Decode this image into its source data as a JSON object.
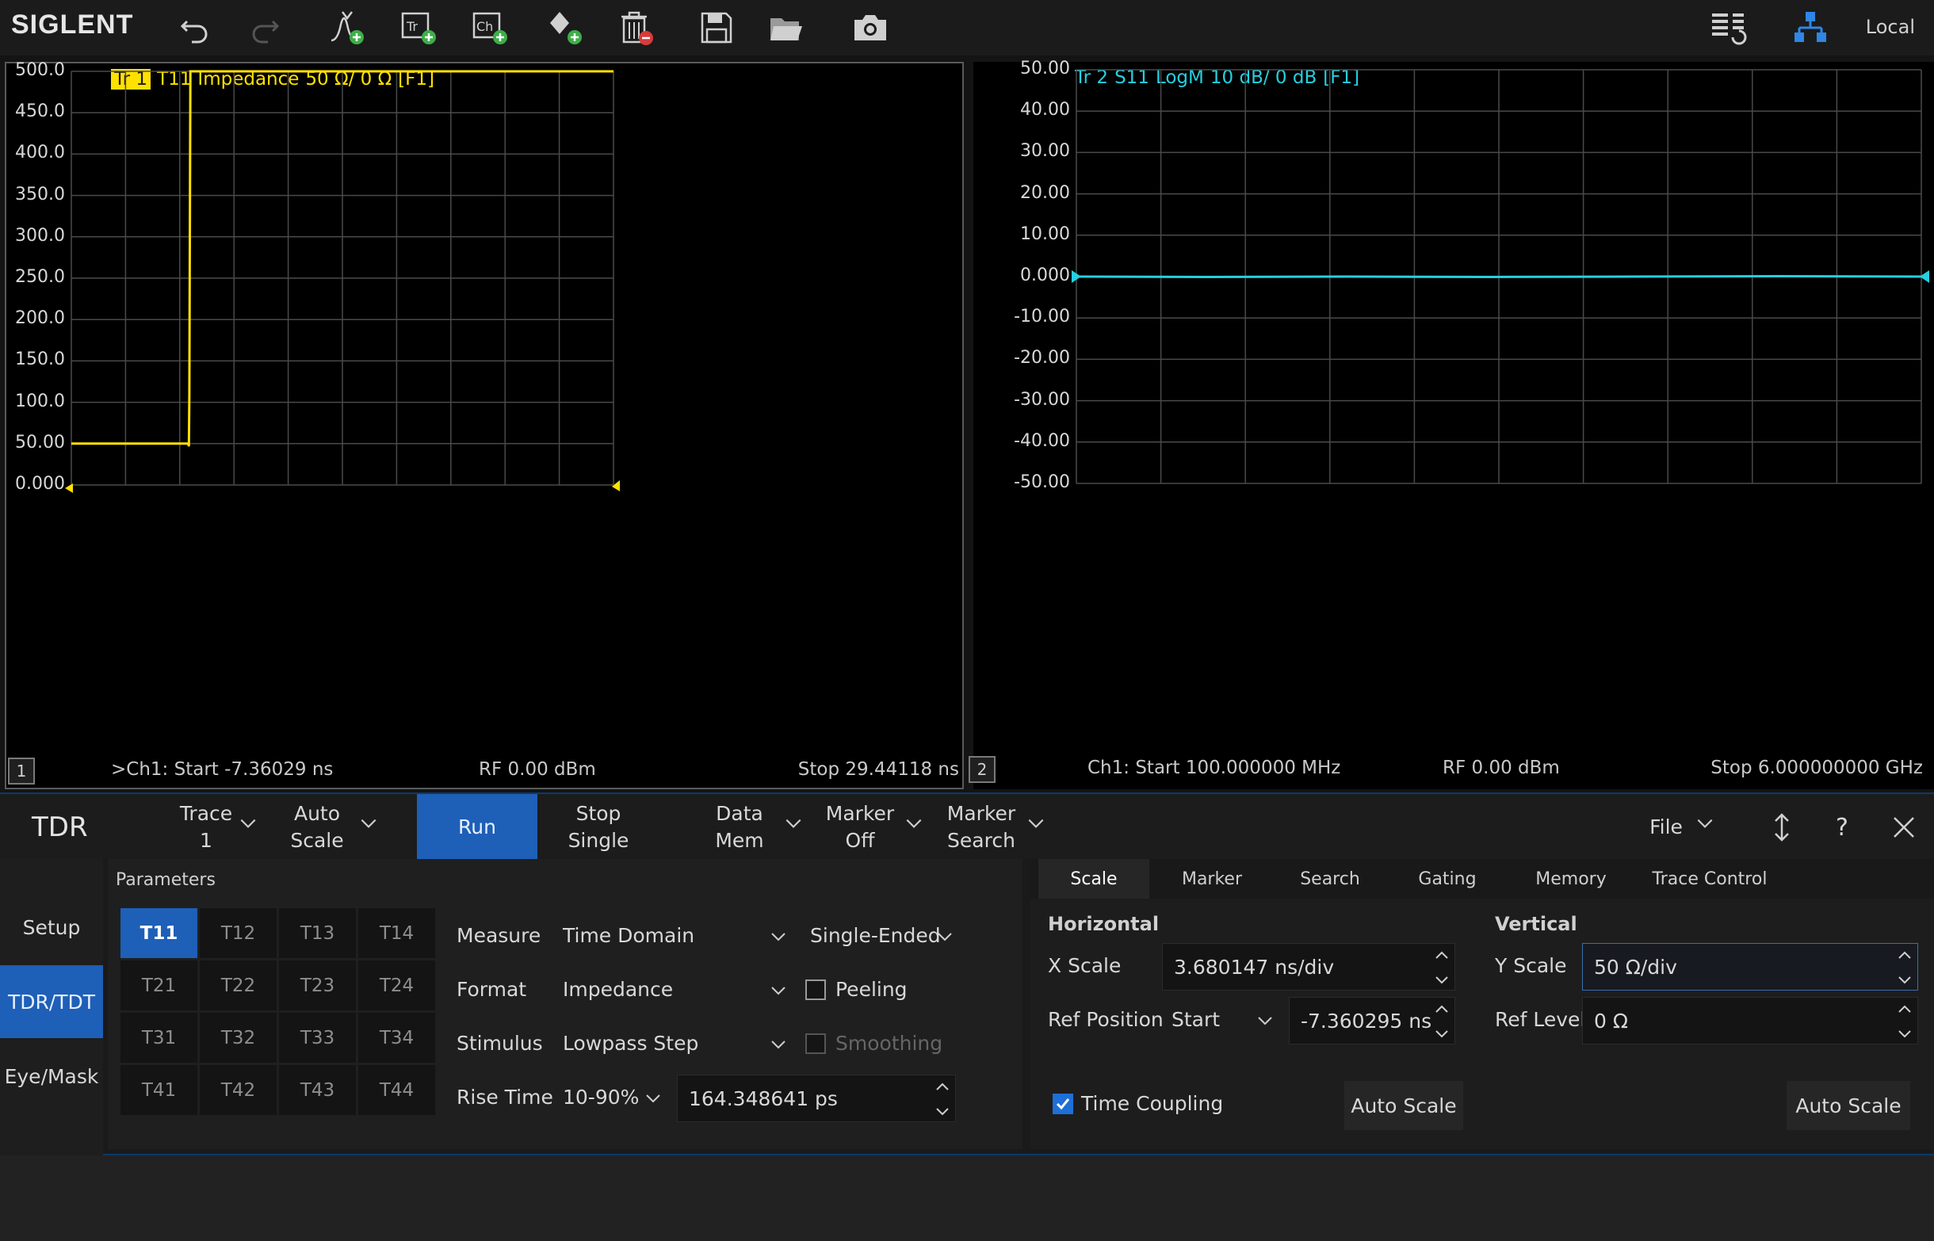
{
  "toolbar": {
    "brand": "SIGLENT",
    "local": "Local",
    "icons": [
      "undo-icon",
      "redo-icon",
      "add-marker-icon",
      "add-trace-icon",
      "add-channel-icon",
      "add-fill-icon",
      "delete-icon",
      "save-icon",
      "open-folder-icon",
      "camera-icon",
      "layout-icon",
      "network-icon"
    ]
  },
  "trace1": {
    "badge": "Tr 1",
    "param": "T11",
    "format": "Impedance",
    "scale": "50 Ω/ 0 Ω",
    "function": "[F1]",
    "color": "#ffe100",
    "yticks": [
      "500.0",
      "450.0",
      "400.0",
      "350.0",
      "300.0",
      "250.0",
      "200.0",
      "150.0",
      "100.0",
      "50.00",
      "0.000"
    ],
    "channel_box": "1",
    "start": ">Ch1: Start -7.36029 ns",
    "power": "RF 0.00 dBm",
    "stop": "Stop 29.44118 ns"
  },
  "trace2": {
    "badge": "Tr 2",
    "param": "S11",
    "format": "LogM",
    "scale": "10 dB/ 0 dB",
    "function": "[F1]",
    "color": "#25d0e0",
    "yticks": [
      "50.00",
      "40.00",
      "30.00",
      "20.00",
      "10.00",
      "0.000",
      "-10.00",
      "-20.00",
      "-30.00",
      "-40.00",
      "-50.00"
    ],
    "channel_box": "2",
    "start": "Ch1: Start 100.000000 MHz",
    "power": "RF 0.00 dBm",
    "stop": "Stop 6.000000000 GHz"
  },
  "chart_data": [
    {
      "type": "line",
      "title": "Tr 1 T11 Impedance 50 Ω/ 0 Ω [F1]",
      "x_range_ns": [
        -7.36029,
        29.44118
      ],
      "ylim": [
        0,
        500
      ],
      "y_step": 50,
      "grid": true,
      "series": [
        {
          "name": "T11",
          "x": [
            -7.36,
            0.55,
            0.6,
            0.62,
            0.65,
            0.7,
            0.72,
            29.44
          ],
          "y": [
            50,
            50,
            48,
            48,
            110,
            385,
            500,
            500
          ]
        }
      ]
    },
    {
      "type": "line",
      "title": "Tr 2 S11 LogM 10 dB/ 0 dB [F1]",
      "x_range_mhz": [
        100,
        6000
      ],
      "ylim": [
        -50,
        50
      ],
      "y_step": 10,
      "grid": true,
      "series": [
        {
          "name": "S11",
          "x": [
            100,
            1000,
            2000,
            3000,
            4000,
            5000,
            6000
          ],
          "y": [
            0.0,
            -0.1,
            0.0,
            -0.1,
            0.0,
            0.1,
            0.0
          ]
        }
      ]
    }
  ],
  "softkeys": {
    "title": "TDR",
    "trace_l1": "Trace",
    "trace_l2": "1",
    "autoscale_l1": "Auto",
    "autoscale_l2": "Scale",
    "run": "Run",
    "stop_l1": "Stop",
    "stop_l2": "Single",
    "datamem_l1": "Data",
    "datamem_l2": "Mem",
    "marker_l1": "Marker",
    "marker_l2": "Off",
    "msearch_l1": "Marker",
    "msearch_l2": "Search",
    "file": "File",
    "help": "?"
  },
  "side_tabs": [
    "Setup",
    "TDR/TDT",
    "Eye/Mask"
  ],
  "parameters": {
    "title": "Parameters",
    "grid": [
      "T11",
      "T12",
      "T13",
      "T14",
      "T21",
      "T22",
      "T23",
      "T24",
      "T31",
      "T32",
      "T33",
      "T34",
      "T41",
      "T42",
      "T43",
      "T44"
    ],
    "selected": "T11",
    "measure_label": "Measure",
    "measure_value": "Time Domain",
    "ended_value": "Single-Ended",
    "format_label": "Format",
    "format_value": "Impedance",
    "peeling_label": "Peeling",
    "stimulus_label": "Stimulus",
    "stimulus_value": "Lowpass Step",
    "smoothing_label": "Smoothing",
    "risetime_label": "Rise Time",
    "risetime_mode": "10-90%",
    "risetime_value": "164.348641 ps"
  },
  "scale_panel": {
    "tabs": [
      "Scale",
      "Marker",
      "Search",
      "Gating",
      "Memory",
      "Trace Control"
    ],
    "active_tab": "Scale",
    "horizontal": "Horizontal",
    "vertical": "Vertical",
    "xscale_label": "X Scale",
    "xscale_value": "3.680147 ns/div",
    "refpos_label": "Ref Position",
    "refpos_mode": "Start",
    "refpos_value": "-7.360295 ns",
    "yscale_label": "Y Scale",
    "yscale_value": "50 Ω/div",
    "reflevel_label": "Ref Level",
    "reflevel_value": "0 Ω",
    "timecoupling_label": "Time Coupling",
    "autoscale_h": "Auto Scale",
    "autoscale_v": "Auto Scale"
  }
}
